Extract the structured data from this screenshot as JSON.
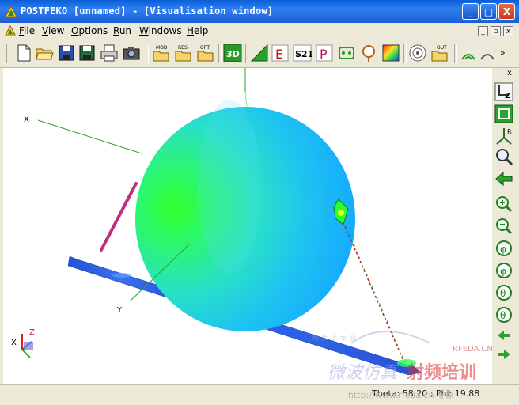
{
  "window": {
    "title": "POSTFEKO [unnamed] - [Visualisation window]",
    "controls": [
      "_",
      "□",
      "X"
    ]
  },
  "menu": {
    "items": [
      "File",
      "View",
      "Options",
      "Run",
      "Windows",
      "Help"
    ]
  },
  "toolbar": {
    "buttons": [
      {
        "name": "new",
        "label": ""
      },
      {
        "name": "open",
        "label": ""
      },
      {
        "name": "save",
        "label": ""
      },
      {
        "name": "save-as",
        "label": ""
      },
      {
        "name": "print",
        "label": ""
      },
      {
        "name": "screenshot",
        "label": ""
      },
      {
        "name": "open-model",
        "label": "MOD"
      },
      {
        "name": "open-results",
        "label": "RES"
      },
      {
        "name": "open-optimisation",
        "label": "OPT"
      },
      {
        "name": "3d-view",
        "label": "3D"
      },
      {
        "name": "far-field",
        "label": ""
      },
      {
        "name": "e-field",
        "label": "E"
      },
      {
        "name": "s-params",
        "label": "S21"
      },
      {
        "name": "power",
        "label": "P"
      },
      {
        "name": "cables",
        "label": ""
      },
      {
        "name": "probe",
        "label": ""
      },
      {
        "name": "colormap",
        "label": ""
      },
      {
        "name": "smith",
        "label": ""
      },
      {
        "name": "open-output",
        "label": "OUT"
      }
    ]
  },
  "viewport": {
    "axis_labels": {
      "x": "X",
      "y": "Y"
    },
    "triad_labels": {
      "x": "X",
      "z": "Z"
    }
  },
  "status": {
    "text": "Theta: 58.20 ; Phi: 19.88"
  },
  "watermark": {
    "line1": "微波仿真",
    "line2": "射频培训",
    "site": "RFEDA.CN",
    "sub": "http://www.rfeda.cn 专家"
  },
  "colors": {
    "title_bar": "#1a5ed6",
    "sphere_green": "#2cff2c",
    "sphere_blue": "#17b0ff",
    "plate_blue": "#2a5fe0",
    "dipole": "#c0307a"
  }
}
